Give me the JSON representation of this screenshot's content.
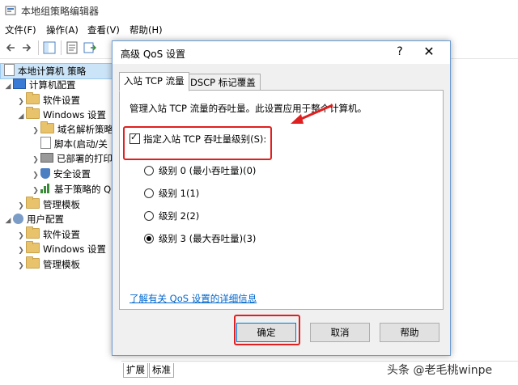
{
  "window": {
    "title": "本地组策略编辑器"
  },
  "menu": [
    "文件(F)",
    "操作(A)",
    "查看(V)",
    "帮助(H)"
  ],
  "tree": {
    "root": "本地计算机 策略",
    "computer_config": "计算机配置",
    "software_settings": "软件设置",
    "windows_settings": "Windows 设置",
    "dns_policy": "域名解析策略",
    "scripts": "脚本(启动/关",
    "deployed_printers": "已部署的打印",
    "security_settings": "安全设置",
    "policy_based": "基于策略的 Q",
    "admin_templates": "管理模板",
    "user_config": "用户配置",
    "user_software": "软件设置",
    "user_windows": "Windows 设置",
    "user_admin": "管理模板"
  },
  "bottom_tabs": [
    "扩展",
    "标准"
  ],
  "dialog": {
    "title": "高级 QoS 设置",
    "help_glyph": "?",
    "close_glyph": "✕",
    "tabs": [
      "入站 TCP 流量",
      "DSCP 标记覆盖"
    ],
    "description": "管理入站 TCP 流量的吞吐量。此设置应用于整个计算机。",
    "checkbox_label": "指定入站 TCP 吞吐量级别(S):",
    "checkbox_checked": true,
    "levels": [
      {
        "label": "级别 0 (最小吞吐量)(0)",
        "selected": false
      },
      {
        "label": "级别 1(1)",
        "selected": false
      },
      {
        "label": "级别 2(2)",
        "selected": false
      },
      {
        "label": "级别 3 (最大吞吐量)(3)",
        "selected": true
      }
    ],
    "learn_more": "了解有关 QoS 设置的详细信息",
    "ok": "确定",
    "cancel": "取消",
    "help": "帮助"
  },
  "watermark": "头条 @老毛桃winpe",
  "colors": {
    "selection_bg": "#cce4f7",
    "dialog_border": "#6b9bd1",
    "annotation_red": "#e02020",
    "link": "#0066cc"
  }
}
